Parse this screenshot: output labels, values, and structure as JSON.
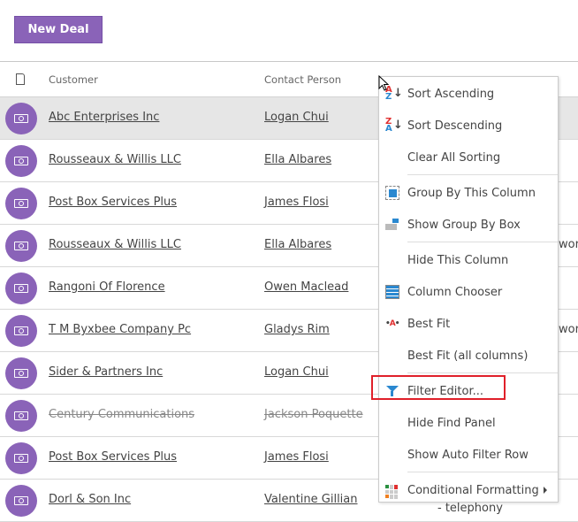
{
  "toolbar": {
    "new_deal_label": "New Deal"
  },
  "colors": {
    "accent": "#8a63b8",
    "highlight_box": "#e0202a",
    "selected_row": "#e6e6e6"
  },
  "grid": {
    "columns": [
      "Customer",
      "Contact Person"
    ],
    "rows": [
      {
        "customer": "Abc Enterprises Inc",
        "contact": "Logan Chui",
        "extra": "",
        "selected": true
      },
      {
        "customer": "Rousseaux & Willis LLC",
        "contact": "Ella Albares",
        "extra": ""
      },
      {
        "customer": "Post Box Services Plus",
        "contact": "James Flosi",
        "extra": ""
      },
      {
        "customer": "Rousseaux & Willis LLC",
        "contact": "Ella Albares",
        "extra": "work"
      },
      {
        "customer": "Rangoni Of Florence",
        "contact": "Owen Maclead",
        "extra": ""
      },
      {
        "customer": "T M Byxbee Company Pc",
        "contact": "Gladys Rim",
        "extra": "work"
      },
      {
        "customer": "Sider & Partners Inc",
        "contact": "Logan Chui",
        "extra": ""
      },
      {
        "customer": "Century Communications",
        "contact": "Jackson Poquette",
        "extra": "",
        "strikethrough": true
      },
      {
        "customer": "Post Box Services Plus",
        "contact": "James Flosi",
        "extra": ""
      },
      {
        "customer": "Dorl & Son Inc",
        "contact": "Valentine Gillian",
        "extra": ""
      }
    ],
    "partial_text": "- telephony"
  },
  "context_menu": {
    "items": [
      {
        "label": "Sort Ascending",
        "icon": "sort-ascending-icon"
      },
      {
        "label": "Sort Descending",
        "icon": "sort-descending-icon"
      },
      {
        "label": "Clear All Sorting"
      },
      {
        "label": "Group By This Column",
        "icon": "group-by-column-icon"
      },
      {
        "label": "Show Group By Box",
        "icon": "group-by-box-icon"
      },
      {
        "label": "Hide This Column"
      },
      {
        "label": "Column Chooser",
        "icon": "column-chooser-icon"
      },
      {
        "label": "Best Fit",
        "icon": "best-fit-icon"
      },
      {
        "label": "Best Fit (all columns)"
      },
      {
        "label": "Filter Editor...",
        "icon": "filter-icon",
        "highlighted": true
      },
      {
        "label": "Hide Find Panel"
      },
      {
        "label": "Show Auto Filter Row"
      },
      {
        "label": "Conditional Formatting",
        "icon": "conditional-formatting-icon",
        "submenu": true
      }
    ]
  }
}
